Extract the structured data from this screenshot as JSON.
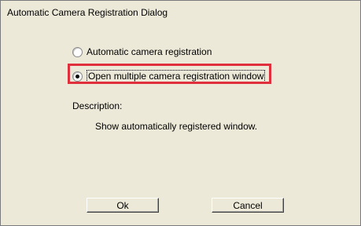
{
  "dialog": {
    "title": "Automatic Camera Registration Dialog"
  },
  "options": [
    {
      "label": "Automatic camera registration",
      "selected": false
    },
    {
      "label": "Open multiple camera registration window",
      "selected": true
    }
  ],
  "description": {
    "label": "Description:",
    "text": "Show automatically registered window."
  },
  "buttons": {
    "ok": "Ok",
    "cancel": "Cancel"
  },
  "colors": {
    "background": "#ece9d8",
    "highlight": "#e0303e"
  }
}
